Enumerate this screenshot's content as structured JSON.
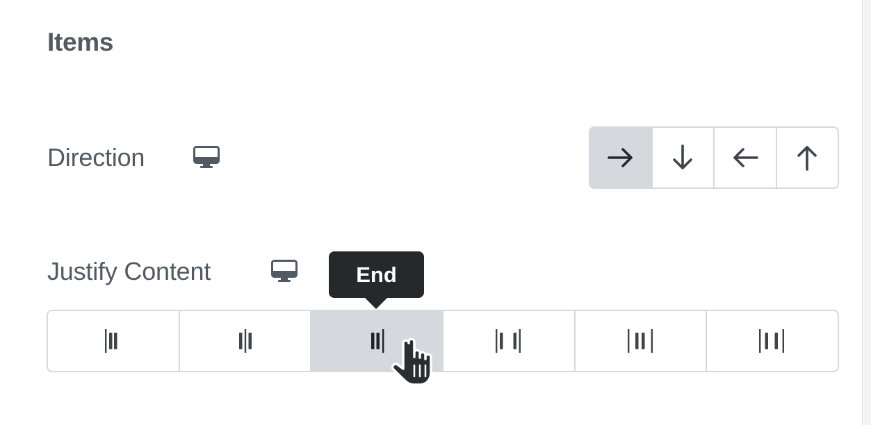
{
  "section": {
    "title": "Items"
  },
  "direction": {
    "label": "Direction",
    "device_icon": "desktop-icon",
    "options": [
      {
        "icon": "arrow-right-icon",
        "active": true
      },
      {
        "icon": "arrow-down-icon",
        "active": false
      },
      {
        "icon": "arrow-left-icon",
        "active": false
      },
      {
        "icon": "arrow-up-icon",
        "active": false
      }
    ]
  },
  "justify": {
    "label": "Justify Content",
    "device_icon": "desktop-icon",
    "tooltip": "End",
    "options": [
      {
        "icon": "justify-start-icon",
        "active": false
      },
      {
        "icon": "justify-center-icon",
        "active": false
      },
      {
        "icon": "justify-end-icon",
        "active": true
      },
      {
        "icon": "justify-space-between-icon",
        "active": false
      },
      {
        "icon": "justify-space-around-icon",
        "active": false
      },
      {
        "icon": "justify-space-evenly-icon",
        "active": false
      }
    ]
  },
  "colors": {
    "text": "#515962",
    "border": "#d5d8dc",
    "active_bg": "#d5d8dc",
    "tooltip_bg": "#26292c",
    "icon": "#3f444b"
  }
}
